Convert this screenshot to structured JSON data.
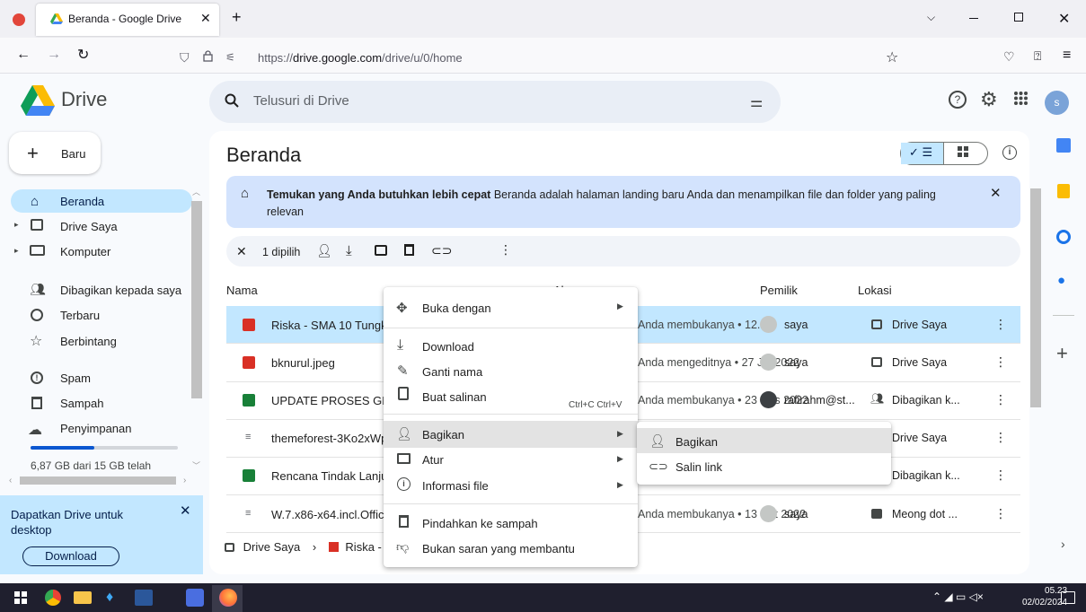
{
  "browser": {
    "tab_title": "Beranda - Google Drive",
    "url_prefix": "https://",
    "url_domain": "drive.google.com",
    "url_path": "/drive/u/0/home"
  },
  "header": {
    "app_name": "Drive",
    "search_placeholder": "Telusuri di Drive",
    "avatar_letter": "s"
  },
  "sidebar": {
    "new_label": "Baru",
    "items": [
      {
        "label": "Beranda"
      },
      {
        "label": "Drive Saya"
      },
      {
        "label": "Komputer"
      },
      {
        "label": "Dibagikan kepada saya"
      },
      {
        "label": "Terbaru"
      },
      {
        "label": "Berbintang"
      },
      {
        "label": "Spam"
      },
      {
        "label": "Sampah"
      },
      {
        "label": "Penyimpanan"
      }
    ],
    "storage_text": "6,87 GB dari 15 GB telah",
    "storage_fraction": 0.458,
    "promo_title": "Dapatkan Drive untuk desktop",
    "promo_button": "Download"
  },
  "main": {
    "title": "Beranda",
    "banner_bold": "Temukan yang Anda butuhkan lebih cepat",
    "banner_text": "Beranda adalah halaman landing baru Anda dan menampilkan file dan folder yang paling relevan",
    "selected_count": "1 dipilih",
    "columns": {
      "name": "Nama",
      "reason": "Alasan saran",
      "owner": "Pemilik",
      "location": "Lokasi"
    },
    "files": [
      {
        "name": "Riska - SMA 10 Tungkal",
        "reason": "Anda membukanya • 12.23",
        "owner": "saya",
        "location": "Drive Saya",
        "type": "video",
        "color": "#d93025"
      },
      {
        "name": "bknurul.jpeg",
        "reason": "Anda mengeditnya • 27 Jul 2022",
        "owner": "saya",
        "location": "Drive Saya",
        "type": "image",
        "color": "#d93025"
      },
      {
        "name": "UPDATE PROSES GB AKHIR",
        "reason": "Anda membukanya • 23 Des 2022",
        "owner": "rafirahm@st...",
        "location": "Dibagikan k...",
        "type": "sheet",
        "color": "#188038"
      },
      {
        "name": "themeforest-3Ko2xWp",
        "reason": "",
        "owner": "",
        "location": "Drive Saya",
        "type": "zip",
        "color": "#5f6368"
      },
      {
        "name": "Rencana Tindak Lanjut",
        "reason": "",
        "owner": "",
        "location": "Dibagikan k...",
        "type": "sheet",
        "color": "#188038"
      },
      {
        "name": "W.7.x86-x64.incl.Office",
        "reason": "Anda membukanya • 13 Okt 2022",
        "owner": "saya",
        "location": "Meong dot ...",
        "type": "zip",
        "color": "#5f6368"
      }
    ],
    "breadcrumb": [
      "Drive Saya",
      "Riska - SMA 10 Tungkal"
    ]
  },
  "context_menu": {
    "items": [
      {
        "label": "Buka dengan"
      },
      {
        "label": "Download"
      },
      {
        "label": "Ganti nama"
      },
      {
        "label": "Buat salinan",
        "shortcut": "Ctrl+C Ctrl+V"
      },
      {
        "label": "Bagikan"
      },
      {
        "label": "Atur"
      },
      {
        "label": "Informasi file"
      },
      {
        "label": "Pindahkan ke sampah"
      },
      {
        "label": "Bukan saran yang membantu"
      }
    ],
    "submenu": [
      {
        "label": "Bagikan"
      },
      {
        "label": "Salin link"
      }
    ]
  },
  "taskbar": {
    "time": "05.23",
    "date": "02/02/2024"
  }
}
